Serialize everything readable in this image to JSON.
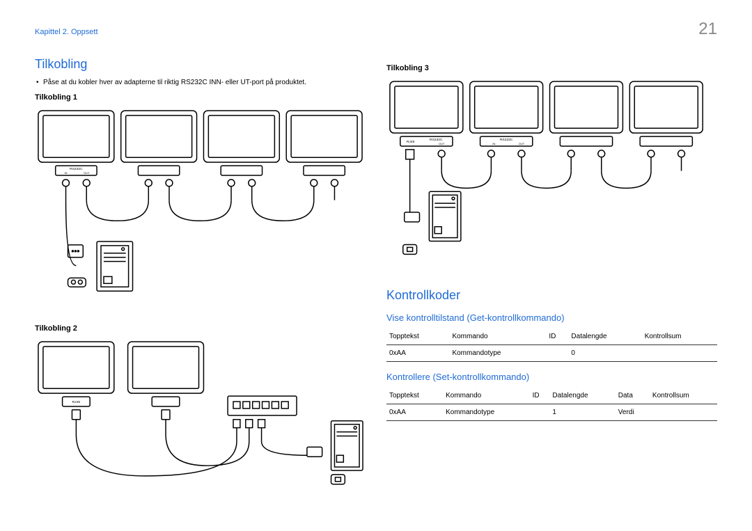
{
  "page_number": "21",
  "chapter": "Kapittel 2. Oppsett",
  "left": {
    "heading": "Tilkobling",
    "bullet": "Påse at du kobler hver av adapterne til riktig RS232C INN- eller UT-port på produktet.",
    "sub1": "Tilkobling 1",
    "sub2": "Tilkobling 2",
    "diagram1_labels": {
      "port": "RS232C",
      "in": "IN",
      "out": "OUT"
    },
    "diagram2_labels": {
      "port": "RJ45"
    }
  },
  "right": {
    "sub3": "Tilkobling 3",
    "diagram3_labels": {
      "rj": "RJ45",
      "rs": "RS232C",
      "in": "IN",
      "out": "OUT"
    },
    "heading2": "Kontrollkoder",
    "h3a": "Vise kontrolltilstand (Get-kontrollkommando)",
    "table_a": {
      "headers": [
        "Topptekst",
        "Kommando",
        "ID",
        "Datalengde",
        "Kontrollsum"
      ],
      "row": [
        "0xAA",
        "Kommandotype",
        "",
        "0",
        ""
      ]
    },
    "h3b": "Kontrollere (Set-kontrollkommando)",
    "table_b": {
      "headers": [
        "Topptekst",
        "Kommando",
        "ID",
        "Datalengde",
        "Data",
        "Kontrollsum"
      ],
      "row": [
        "0xAA",
        "Kommandotype",
        "",
        "1",
        "Verdi",
        ""
      ]
    }
  }
}
